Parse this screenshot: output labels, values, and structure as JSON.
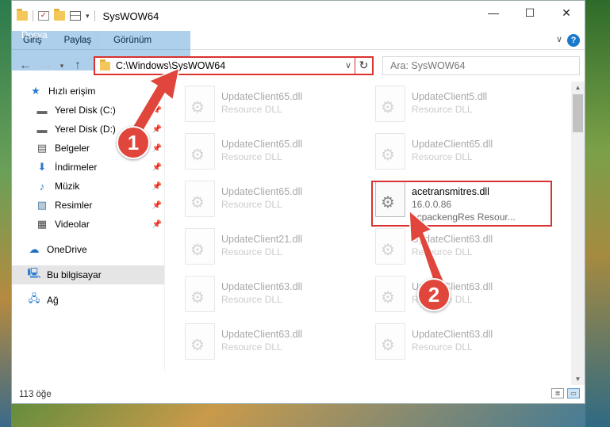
{
  "window": {
    "title": "SysWOW64",
    "controls": {
      "minimize": "—",
      "maximize": "☐",
      "close": "✕"
    }
  },
  "ribbon": {
    "tabs": [
      "Dosya",
      "Giriş",
      "Paylaş",
      "Görünüm"
    ],
    "help": "?",
    "expand": "∨"
  },
  "navigation": {
    "back": "←",
    "forward": "→",
    "recent": "▾",
    "up": "↑",
    "address": "C:\\Windows\\SysWOW64",
    "search_placeholder": "Ara: SysWOW64"
  },
  "nav_pane": {
    "quick_access": "Hızlı erişim",
    "items": [
      {
        "label": "Yerel Disk (C:)",
        "icon": "drive-icon",
        "pinned": true
      },
      {
        "label": "Yerel Disk (D:)",
        "icon": "drive-icon",
        "pinned": true
      },
      {
        "label": "Belgeler",
        "icon": "documents-icon",
        "pinned": true
      },
      {
        "label": "İndirmeler",
        "icon": "downloads-icon",
        "pinned": true
      },
      {
        "label": "Müzik",
        "icon": "music-icon",
        "pinned": true
      },
      {
        "label": "Resimler",
        "icon": "pictures-icon",
        "pinned": true
      },
      {
        "label": "Videolar",
        "icon": "videos-icon",
        "pinned": true
      }
    ],
    "onedrive": "OneDrive",
    "this_pc": "Bu bilgisayar",
    "network": "Ağ"
  },
  "files": {
    "col1": [
      {
        "name": "UpdateClient65.dll",
        "type": "Resource DLL"
      },
      {
        "name": "UpdateClient65.dll",
        "type": "Resource DLL"
      },
      {
        "name": "UpdateClient65.dll",
        "type": "Resource DLL"
      },
      {
        "name": "UpdateClient21.dll",
        "type": "Resource DLL"
      },
      {
        "name": "UpdateClient63.dll",
        "type": "Resource DLL"
      },
      {
        "name": "UpdateClient63.dll",
        "type": "Resource DLL"
      }
    ],
    "col2": [
      {
        "name": "UpdateClient5.dll",
        "type": "Resource DLL"
      },
      {
        "name": "UpdateClient65.dll",
        "type": "Resource DLL"
      },
      {
        "name": "UpdateClient63.dll",
        "type": "Resource DLL"
      },
      {
        "name": "UpdateClient63.dll",
        "type": "Resource DLL"
      },
      {
        "name": "UpdateClient63.dll",
        "type": "Resource DLL"
      }
    ],
    "highlighted": {
      "name": "acetransmitres.dll",
      "version": "16.0.0.86",
      "description": "acpackengRes Resour..."
    }
  },
  "callouts": {
    "one": "1",
    "two": "2"
  },
  "status": {
    "count": "113 öğe"
  },
  "colors": {
    "accent": "#1979ca",
    "callout": "#e0463c",
    "highlight": "#d9322f"
  }
}
